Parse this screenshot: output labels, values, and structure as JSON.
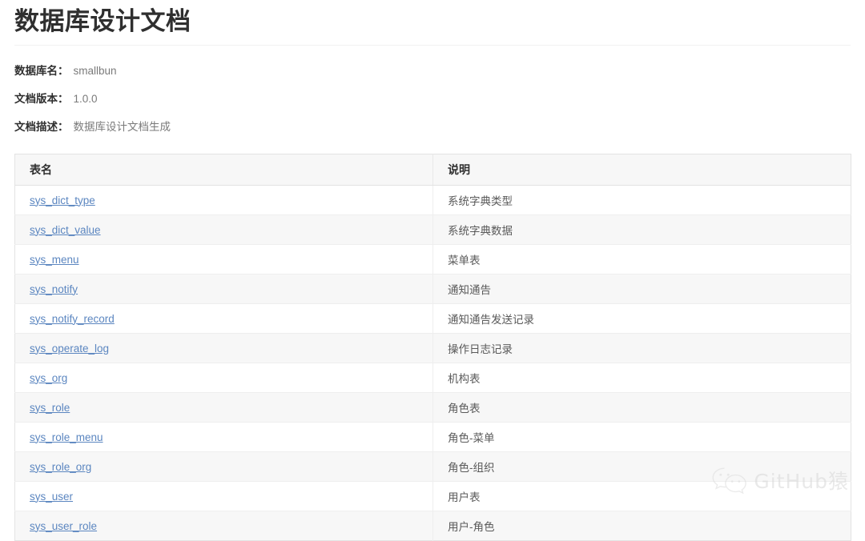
{
  "document": {
    "title": "数据库设计文档",
    "meta": [
      {
        "label": "数据库名：",
        "value": "smallbun"
      },
      {
        "label": "文档版本：",
        "value": "1.0.0"
      },
      {
        "label": "文档描述：",
        "value": "数据库设计文档生成"
      }
    ]
  },
  "table": {
    "columns": [
      "表名",
      "说明"
    ],
    "rows": [
      {
        "name": "sys_dict_type",
        "desc": "系统字典类型"
      },
      {
        "name": "sys_dict_value",
        "desc": "系统字典数据"
      },
      {
        "name": "sys_menu",
        "desc": "菜单表"
      },
      {
        "name": "sys_notify",
        "desc": "通知通告"
      },
      {
        "name": "sys_notify_record",
        "desc": "通知通告发送记录"
      },
      {
        "name": "sys_operate_log",
        "desc": "操作日志记录"
      },
      {
        "name": "sys_org",
        "desc": "机构表"
      },
      {
        "name": "sys_role",
        "desc": "角色表"
      },
      {
        "name": "sys_role_menu",
        "desc": "角色-菜单"
      },
      {
        "name": "sys_role_org",
        "desc": "角色-组织"
      },
      {
        "name": "sys_user",
        "desc": "用户表"
      },
      {
        "name": "sys_user_role",
        "desc": "用户-角色"
      }
    ]
  },
  "watermark": {
    "text": "GitHub猿",
    "icon": "wechat-icon"
  },
  "colors": {
    "link": "#5b86c0",
    "title": "#2f2f2f",
    "meta_value": "#7a7a7a",
    "row_alt": "#f7f7f7",
    "border": "#e3e3e3"
  }
}
